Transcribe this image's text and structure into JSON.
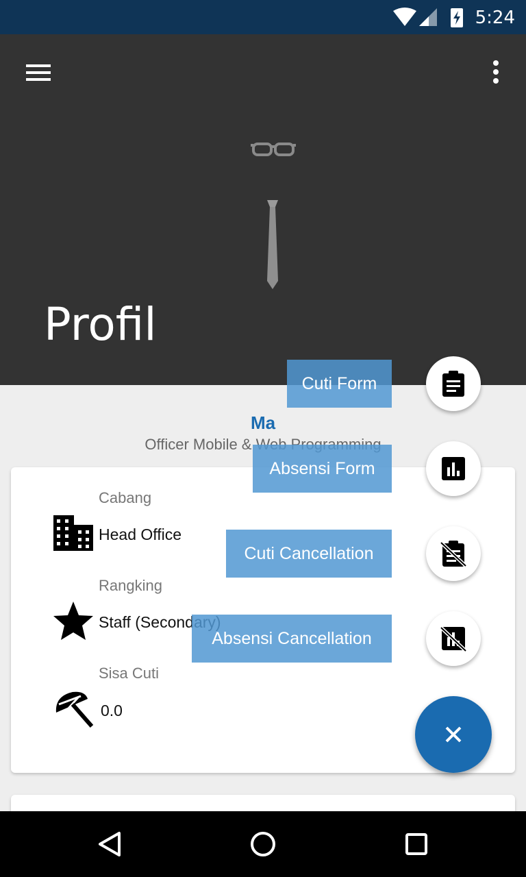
{
  "status_bar": {
    "time": "5:24",
    "icons": [
      "wifi-icon",
      "cell-signal-icon",
      "battery-charging-icon"
    ]
  },
  "app_bar": {
    "title": "Profil",
    "menu_icon": "menu-icon",
    "overflow_icon": "more-vert-icon"
  },
  "profile": {
    "name": "Ma",
    "role": "Officer Mobile & Web Programming"
  },
  "details": {
    "branch": {
      "label": "Cabang",
      "value": "Head Office",
      "icon": "building-icon"
    },
    "rank": {
      "label": "Rangking",
      "value": "Staff (Secondary)",
      "icon": "star-icon"
    },
    "leave": {
      "label": "Sisa Cuti",
      "value": "0.0",
      "icon": "beach-umbrella-icon"
    }
  },
  "fab_menu": {
    "items": [
      {
        "label": "Cuti Form",
        "icon": "assignment-icon"
      },
      {
        "label": "Absensi Form",
        "icon": "chart-icon"
      },
      {
        "label": "Cuti Cancellation",
        "icon": "assignment-cancel-icon"
      },
      {
        "label": "Absensi Cancellation",
        "icon": "chart-cancel-icon"
      }
    ],
    "close_icon": "close-icon"
  },
  "colors": {
    "status_bar": "#0f3456",
    "app_bar": "#333333",
    "accent": "#1a6bb0",
    "label_bg": "#5198d2"
  },
  "nav_bar": {
    "icons": [
      "back-icon",
      "home-icon",
      "recents-icon"
    ]
  }
}
